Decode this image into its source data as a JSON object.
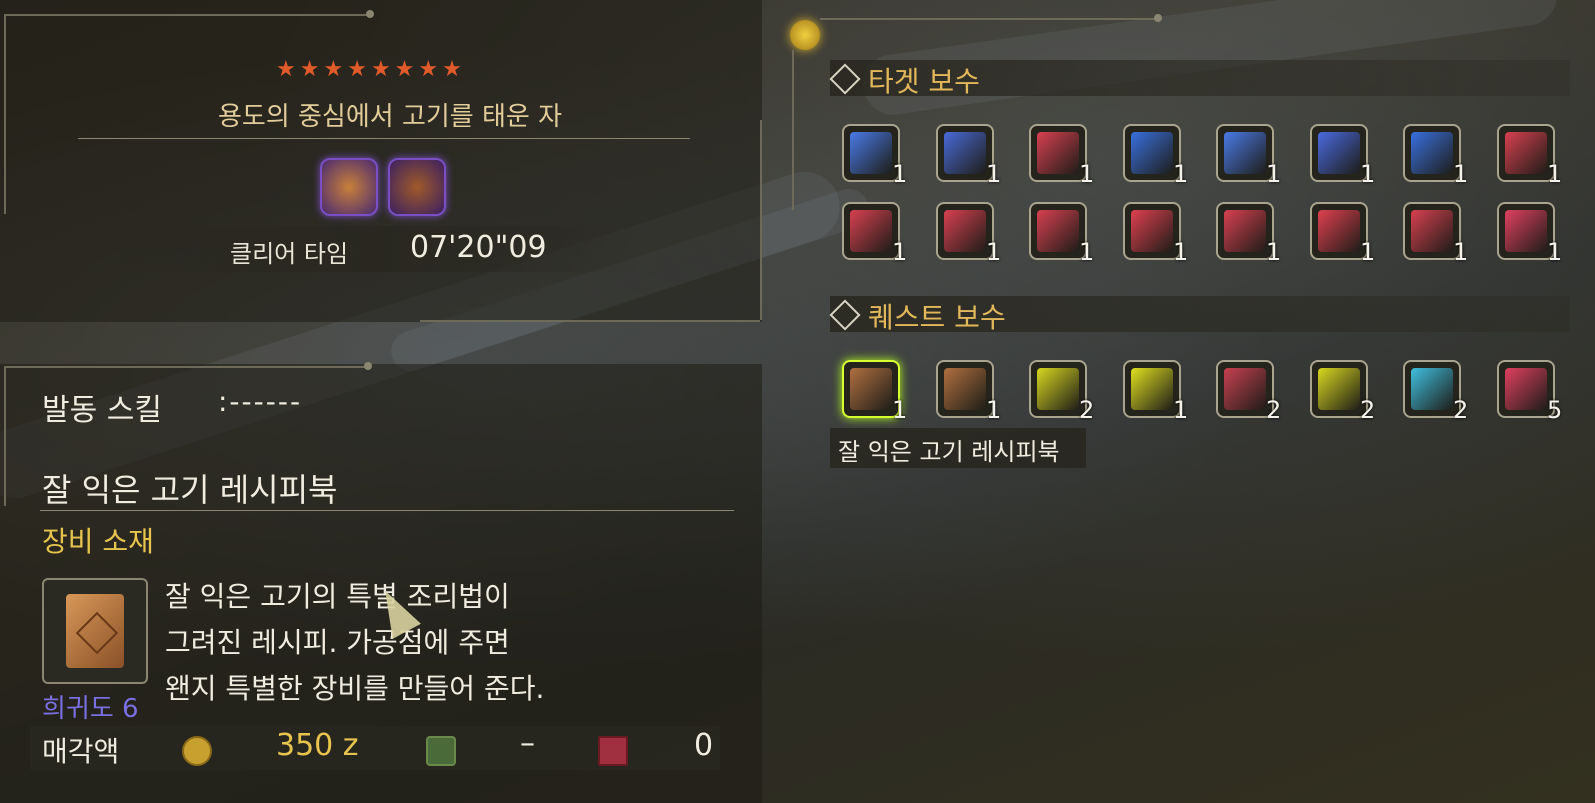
{
  "quest": {
    "stars": [
      "★",
      "★",
      "★",
      "★",
      "★",
      "★",
      "★",
      "★"
    ],
    "title": "용도의 중심에서 고기를 태운 자",
    "monsters": [
      {
        "name": "monster-icon-a",
        "color": "#c8803a"
      },
      {
        "name": "monster-icon-b",
        "color": "#a05a2a"
      }
    ],
    "clear_time_label": "클리어 타임",
    "clear_time_value": "07'20\"09"
  },
  "detail": {
    "skill_label": "발동 스킬",
    "skill_value": ":------",
    "item_name": "잘 익은 고기 레시피북",
    "category": "장비 소재",
    "description_lines": [
      "잘 익은 고기의 특별 조리법이",
      "그려진 레시피. 가공점에 주면",
      "왠지 특별한 장비를 만들어 준다."
    ],
    "rarity": "희귀도 6",
    "sell_label": "매각액",
    "sell_zenny": "350 z",
    "sell_points": "–",
    "sell_other": "0",
    "colors": {
      "zenny": "#e6c44e",
      "rarity": "#7a6fe0",
      "category": "#e6c44e"
    }
  },
  "target_rewards": {
    "title": "타겟 보수",
    "items": [
      {
        "icon": "scroll-icon",
        "color": "#4a7ae8",
        "qty": "1"
      },
      {
        "icon": "horn-icon",
        "color": "#4a6ad8",
        "qty": "1"
      },
      {
        "icon": "claw-icon",
        "color": "#d84050",
        "qty": "1"
      },
      {
        "icon": "carapace-icon",
        "color": "#3a70e0",
        "qty": "1"
      },
      {
        "icon": "scroll-icon",
        "color": "#4a7ae8",
        "qty": "1"
      },
      {
        "icon": "orb-icon",
        "color": "#4a6ae0",
        "qty": "1"
      },
      {
        "icon": "carapace-icon",
        "color": "#3a70e0",
        "qty": "1"
      },
      {
        "icon": "sac-icon",
        "color": "#d84050",
        "qty": "1"
      },
      {
        "icon": "scroll-icon",
        "color": "#d84050",
        "qty": "1"
      },
      {
        "icon": "scroll-icon",
        "color": "#d84050",
        "qty": "1"
      },
      {
        "icon": "horn-icon",
        "color": "#d84050",
        "qty": "1"
      },
      {
        "icon": "gem-icon",
        "color": "#e04050",
        "qty": "1"
      },
      {
        "icon": "scroll-icon",
        "color": "#d84050",
        "qty": "1"
      },
      {
        "icon": "gem-icon",
        "color": "#e04050",
        "qty": "1"
      },
      {
        "icon": "orb-icon",
        "color": "#d84050",
        "qty": "1"
      },
      {
        "icon": "flask-icon",
        "color": "#e04060",
        "qty": "1"
      }
    ]
  },
  "quest_rewards": {
    "title": "퀘스트 보수",
    "items": [
      {
        "icon": "recipe-book-icon",
        "color": "#b07040",
        "qty": "1",
        "selected": true
      },
      {
        "icon": "recipe-book-icon",
        "color": "#b07040",
        "qty": "1"
      },
      {
        "icon": "jewel-icon",
        "color": "#d8d820",
        "qty": "2"
      },
      {
        "icon": "scroll-icon",
        "color": "#e0e020",
        "qty": "1"
      },
      {
        "icon": "mystery-icon",
        "color": "#c84050",
        "qty": "2"
      },
      {
        "icon": "jewel-icon",
        "color": "#d8d820",
        "qty": "2"
      },
      {
        "icon": "jewel-icon",
        "color": "#40c0e0",
        "qty": "2"
      },
      {
        "icon": "ticket-icon",
        "color": "#e04060",
        "qty": "5"
      }
    ],
    "tooltip": "잘 익은 고기 레시피북"
  }
}
